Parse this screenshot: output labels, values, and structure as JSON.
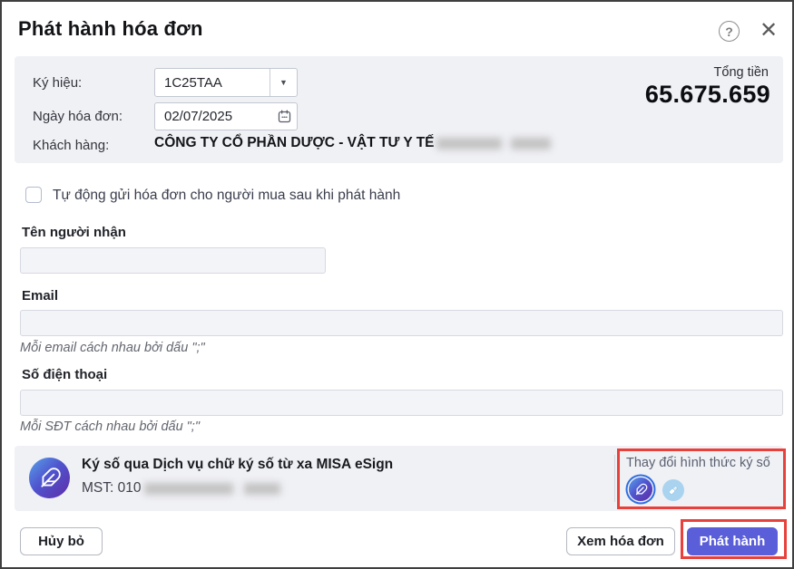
{
  "dialog": {
    "title": "Phát hành hóa đơn",
    "header": {
      "serial_label": "Ký hiệu:",
      "serial_value": "1C25TAA",
      "date_label": "Ngày hóa đơn:",
      "date_value": "02/07/2025",
      "customer_label": "Khách hàng:",
      "customer_value": "CÔNG TY CỔ PHẦN DƯỢC - VẬT TƯ Y TẾ",
      "total_label": "Tổng tiền",
      "total_value": "65.675.659"
    },
    "auto_send_checkbox_label": "Tự động gửi hóa đơn cho người mua sau khi phát hành",
    "recipient": {
      "label": "Tên người nhận",
      "value": ""
    },
    "email": {
      "label": "Email",
      "value": "",
      "hint": "Mỗi email cách nhau bởi dấu \";\""
    },
    "phone": {
      "label": "Số điện thoại",
      "value": "",
      "hint": "Mỗi SĐT cách nhau bởi dấu \";\""
    },
    "esign": {
      "title": "Ký số qua Dịch vụ chữ ký số từ xa MISA eSign",
      "mst_prefix": "MST: 010",
      "change_method_label": "Thay đổi hình thức ký số"
    },
    "buttons": {
      "cancel": "Hủy bỏ",
      "preview": "Xem hóa đơn",
      "publish": "Phát hành"
    }
  },
  "icons": {
    "help": "?",
    "close": "✕",
    "dropdown_caret": "▼"
  },
  "colors": {
    "accent": "#5a5ed8",
    "annotation": "#e8413c",
    "panel": "#f0f1f5"
  }
}
